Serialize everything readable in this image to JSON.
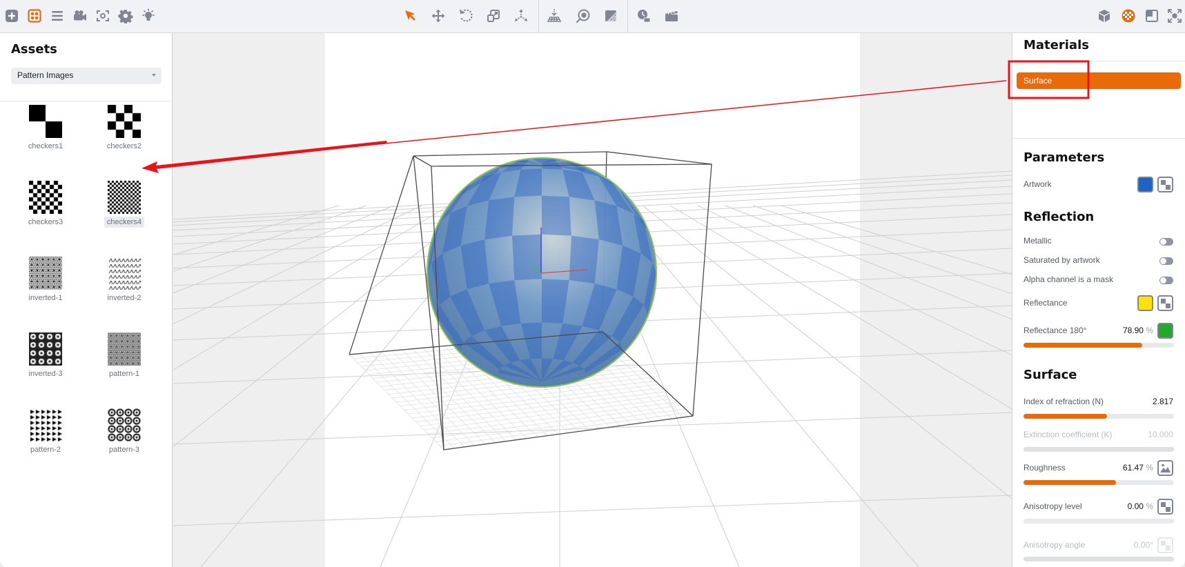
{
  "toolbar": {
    "left_tools": [
      {
        "name": "add-icon",
        "active": false
      },
      {
        "name": "assets-icon",
        "active": true
      },
      {
        "name": "list-icon",
        "active": false
      },
      {
        "name": "camera-icon",
        "active": false
      },
      {
        "name": "focus-icon",
        "active": false
      },
      {
        "name": "gear-icon",
        "active": false
      },
      {
        "name": "light-icon",
        "active": false
      }
    ],
    "center_tools": [
      {
        "name": "select-arrow-icon",
        "active": true
      },
      {
        "name": "move-icon",
        "active": false
      },
      {
        "name": "rotate-icon",
        "active": false
      },
      {
        "name": "scale-icon",
        "active": false
      },
      {
        "name": "pivot-icon",
        "active": false
      },
      {
        "name": "drop-to-floor-icon",
        "active": false
      },
      {
        "name": "look-at-icon",
        "active": false
      },
      {
        "name": "shading-icon",
        "active": false
      },
      {
        "name": "animation-time-icon",
        "active": false
      },
      {
        "name": "clapperboard-icon",
        "active": false
      }
    ],
    "right_tools": [
      {
        "name": "cube-icon",
        "active": false
      },
      {
        "name": "material-ball-icon",
        "active": true
      },
      {
        "name": "window-icon",
        "active": false
      },
      {
        "name": "fullscreen-icon",
        "active": false
      }
    ],
    "accent": "#ea6a0a",
    "icon_color": "#7f8591"
  },
  "assets": {
    "title": "Assets",
    "category": "Pattern Images",
    "items": [
      {
        "label": "checkers1",
        "pattern": "checkers1",
        "selected": false
      },
      {
        "label": "checkers2",
        "pattern": "checkers2",
        "selected": false
      },
      {
        "label": "checkers3",
        "pattern": "checkers3",
        "selected": false
      },
      {
        "label": "checkers4",
        "pattern": "checkers4",
        "selected": true
      },
      {
        "label": "inverted-1",
        "pattern": "inverted1",
        "selected": false
      },
      {
        "label": "inverted-2",
        "pattern": "inverted2",
        "selected": false
      },
      {
        "label": "inverted-3",
        "pattern": "inverted3",
        "selected": false
      },
      {
        "label": "pattern-1",
        "pattern": "pattern1",
        "selected": false
      },
      {
        "label": "pattern-2",
        "pattern": "pattern2",
        "selected": false
      },
      {
        "label": "pattern-3",
        "pattern": "pattern3",
        "selected": false
      }
    ]
  },
  "materials": {
    "title": "Materials",
    "items": [
      {
        "label": "Surface",
        "selected": true
      }
    ]
  },
  "parameters": {
    "title": "Parameters",
    "artwork_label": "Artwork",
    "artwork_color": "#2163c4"
  },
  "reflection": {
    "title": "Reflection",
    "toggles": [
      {
        "label": "Metallic",
        "on": false
      },
      {
        "label": "Saturated by artwork",
        "on": false
      },
      {
        "label": "Alpha channel is a mask",
        "on": false
      }
    ],
    "reflectance_label": "Reflectance",
    "reflectance_color": "#fde20a",
    "reflectance180_label": "Reflectance 180°",
    "reflectance180_value": "78.90",
    "reflectance180_unit": "%",
    "reflectance180_fraction": 0.789,
    "reflectance180_color": "#23a829"
  },
  "surface": {
    "title": "Surface",
    "ior_label": "Index of refraction (N)",
    "ior_value": "2.817",
    "ior_fraction": 0.555,
    "extinction_label": "Extinction coefficient (K)",
    "extinction_value": "10.000",
    "extinction_fraction": 0,
    "roughness_label": "Roughness",
    "roughness_value": "61.47",
    "roughness_unit": "%",
    "roughness_fraction": 0.6147,
    "anisotropy_level_label": "Anisotropy level",
    "anisotropy_level_value": "0.00",
    "anisotropy_level_unit": "%",
    "anisotropy_level_fraction": 0,
    "anisotropy_angle_label": "Anisotropy angle",
    "anisotropy_angle_value": "0.00",
    "anisotropy_angle_unit": "°",
    "anisotropy_angle_fraction": 0
  },
  "viewport": {
    "object": "sphere",
    "sphere_color": "#5b86b8",
    "annotation_color": "#e8141a"
  }
}
